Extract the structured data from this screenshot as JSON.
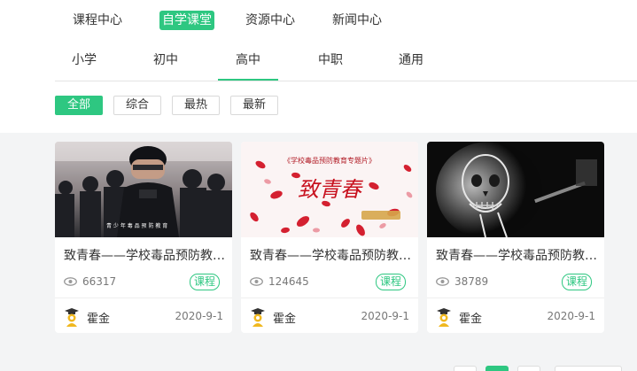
{
  "topnav": {
    "items": [
      {
        "label": "课程中心",
        "active": false
      },
      {
        "label": "自学课堂",
        "active": true
      },
      {
        "label": "资源中心",
        "active": false
      },
      {
        "label": "新闻中心",
        "active": false
      }
    ]
  },
  "subnav": {
    "items": [
      {
        "label": "小学",
        "active": false
      },
      {
        "label": "初中",
        "active": false
      },
      {
        "label": "高中",
        "active": true
      },
      {
        "label": "中职",
        "active": false
      },
      {
        "label": "通用",
        "active": false
      }
    ]
  },
  "filters": {
    "items": [
      {
        "label": "全部",
        "active": true
      },
      {
        "label": "综合",
        "active": false
      },
      {
        "label": "最热",
        "active": false
      },
      {
        "label": "最新",
        "active": false
      }
    ]
  },
  "cards": [
    {
      "title": "致青春——学校毒品预防教育专题片",
      "views": "66317",
      "badge": "课程",
      "author": "霍金",
      "date": "2020-9-1",
      "thumb_icon": "police-squad-thumbnail"
    },
    {
      "title": "致青春——学校毒品预防教育专题片",
      "views": "124645",
      "badge": "课程",
      "author": "霍金",
      "date": "2020-9-1",
      "thumb_icon": "rose-petals-thumbnail",
      "thumb_caption": "《学校毒品预防教育专题片》",
      "thumb_title": "致青春"
    },
    {
      "title": "致青春——学校毒品预防教育专题片",
      "views": "38789",
      "badge": "课程",
      "author": "霍金",
      "date": "2020-9-1",
      "thumb_icon": "xray-skull-thumbnail"
    }
  ],
  "colors": {
    "accent": "#2ec781",
    "background": "#f3f4f5"
  }
}
